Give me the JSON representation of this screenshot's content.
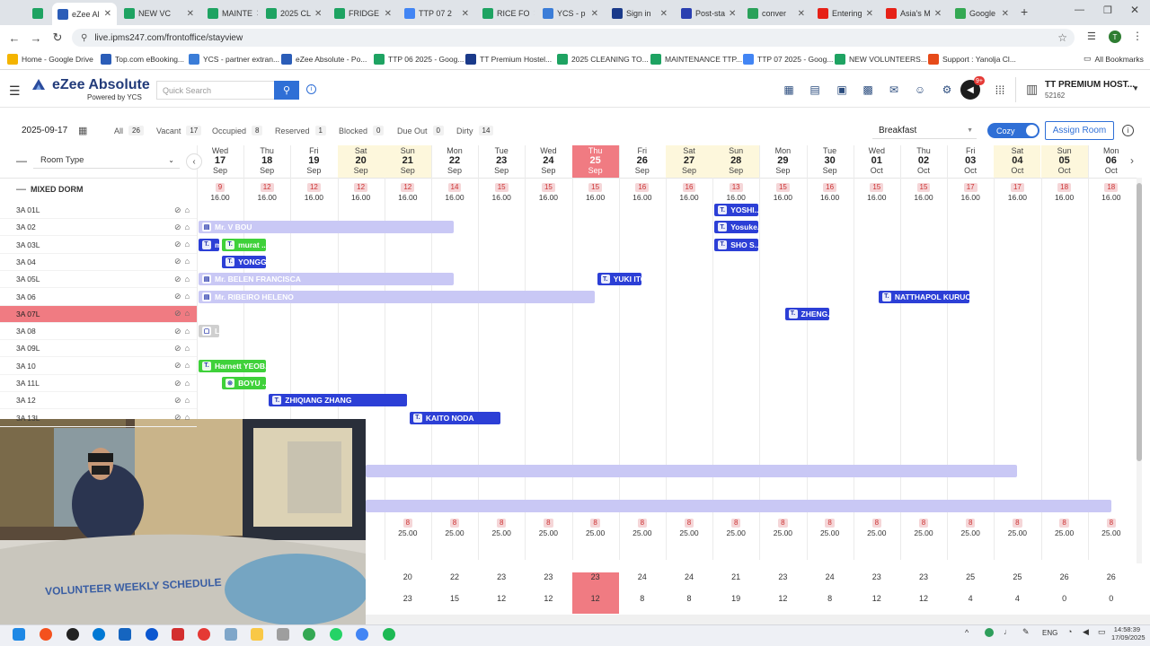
{
  "browser": {
    "tabs": [
      {
        "label": "",
        "icon": "sheets-icon",
        "color": "#1ea362"
      },
      {
        "label": "eZee Al",
        "icon": "ezee-icon",
        "color": "#2b5db8"
      },
      {
        "label": "NEW VC",
        "icon": "sheets-icon",
        "color": "#1ea362"
      },
      {
        "label": "MAINTE",
        "icon": "sheets-icon",
        "color": "#1ea362"
      },
      {
        "label": "2025 CL",
        "icon": "sheets-icon",
        "color": "#1ea362"
      },
      {
        "label": "FRIDGE",
        "icon": "fridge-icon",
        "color": "#1ea362"
      },
      {
        "label": "TTP 07 2",
        "icon": "google-icon",
        "color": "#4285f4"
      },
      {
        "label": "RICE FO",
        "icon": "sheets-icon",
        "color": "#1ea362"
      },
      {
        "label": "YCS - p",
        "icon": "ycs-icon",
        "color": "#3b7dd8"
      },
      {
        "label": "Sign in",
        "icon": "booking-icon",
        "color": "#1a3a8a"
      },
      {
        "label": "Post-sta",
        "icon": "post-icon",
        "color": "#2a3fb0"
      },
      {
        "label": "conver",
        "icon": "convert-icon",
        "color": "#2aa15a"
      },
      {
        "label": "Entering",
        "icon": "youtube-icon",
        "color": "#e62117"
      },
      {
        "label": "Asia's M",
        "icon": "youtube-icon",
        "color": "#e62117"
      },
      {
        "label": "Google",
        "icon": "google-maps-icon",
        "color": "#34a853"
      }
    ],
    "url": "live.ipms247.com/frontoffice/stayview",
    "bookmarks": [
      {
        "label": "Home - Google Drive",
        "color": "#f4b400"
      },
      {
        "label": "Top.com eBooking...",
        "color": "#2b5db8"
      },
      {
        "label": "YCS - partner extran...",
        "color": "#3b7dd8"
      },
      {
        "label": "eZee Absolute - Po...",
        "color": "#2b5db8"
      },
      {
        "label": "TTP 06 2025 - Goog...",
        "color": "#1ea362"
      },
      {
        "label": "TT Premium Hostel...",
        "color": "#1a3a8a"
      },
      {
        "label": "2025 CLEANING TO...",
        "color": "#1ea362"
      },
      {
        "label": "MAINTENANCE TTP...",
        "color": "#1ea362"
      },
      {
        "label": "TTP 07 2025 - Goog...",
        "color": "#4285f4"
      },
      {
        "label": "NEW VOLUNTEERS...",
        "color": "#1ea362"
      },
      {
        "label": "Support : Yanolja Cl...",
        "color": "#e64a19"
      }
    ],
    "all_bookmarks": "All Bookmarks"
  },
  "app": {
    "logo": "eZee Absolute",
    "logo_sub": "Powered by YCS",
    "search_placeholder": "Quick Search",
    "notif_count": "9+",
    "hotel_name": "TT PREMIUM HOST...",
    "hotel_id": "52162"
  },
  "filter": {
    "date": "2025-09-17",
    "stats": [
      {
        "label": "All",
        "count": "26"
      },
      {
        "label": "Vacant",
        "count": "17"
      },
      {
        "label": "Occupied",
        "count": "8"
      },
      {
        "label": "Reserved",
        "count": "1"
      },
      {
        "label": "Blocked",
        "count": "0"
      },
      {
        "label": "Due Out",
        "count": "0"
      },
      {
        "label": "Dirty",
        "count": "14"
      }
    ],
    "meal": "Breakfast",
    "view_toggle": "Cozy",
    "assign_room": "Assign Room",
    "room_type": "Room Type"
  },
  "calendar": {
    "days": [
      {
        "dow": "Wed",
        "d": "17",
        "m": "Sep",
        "avail": "9",
        "price": "16.00",
        "kind": ""
      },
      {
        "dow": "Thu",
        "d": "18",
        "m": "Sep",
        "avail": "12",
        "price": "16.00",
        "kind": ""
      },
      {
        "dow": "Fri",
        "d": "19",
        "m": "Sep",
        "avail": "12",
        "price": "16.00",
        "kind": ""
      },
      {
        "dow": "Sat",
        "d": "20",
        "m": "Sep",
        "avail": "12",
        "price": "16.00",
        "kind": "weekend"
      },
      {
        "dow": "Sun",
        "d": "21",
        "m": "Sep",
        "avail": "12",
        "price": "16.00",
        "kind": "weekend"
      },
      {
        "dow": "Mon",
        "d": "22",
        "m": "Sep",
        "avail": "14",
        "price": "16.00",
        "kind": ""
      },
      {
        "dow": "Tue",
        "d": "23",
        "m": "Sep",
        "avail": "15",
        "price": "16.00",
        "kind": ""
      },
      {
        "dow": "Wed",
        "d": "24",
        "m": "Sep",
        "avail": "15",
        "price": "16.00",
        "kind": ""
      },
      {
        "dow": "Thu",
        "d": "25",
        "m": "Sep",
        "avail": "15",
        "price": "16.00",
        "kind": "today"
      },
      {
        "dow": "Fri",
        "d": "26",
        "m": "Sep",
        "avail": "16",
        "price": "16.00",
        "kind": ""
      },
      {
        "dow": "Sat",
        "d": "27",
        "m": "Sep",
        "avail": "16",
        "price": "16.00",
        "kind": "weekend"
      },
      {
        "dow": "Sun",
        "d": "28",
        "m": "Sep",
        "avail": "13",
        "price": "16.00",
        "kind": "weekend"
      },
      {
        "dow": "Mon",
        "d": "29",
        "m": "Sep",
        "avail": "15",
        "price": "16.00",
        "kind": ""
      },
      {
        "dow": "Tue",
        "d": "30",
        "m": "Sep",
        "avail": "16",
        "price": "16.00",
        "kind": ""
      },
      {
        "dow": "Wed",
        "d": "01",
        "m": "Oct",
        "avail": "15",
        "price": "16.00",
        "kind": ""
      },
      {
        "dow": "Thu",
        "d": "02",
        "m": "Oct",
        "avail": "15",
        "price": "16.00",
        "kind": ""
      },
      {
        "dow": "Fri",
        "d": "03",
        "m": "Oct",
        "avail": "17",
        "price": "16.00",
        "kind": ""
      },
      {
        "dow": "Sat",
        "d": "04",
        "m": "Oct",
        "avail": "17",
        "price": "16.00",
        "kind": "weekend"
      },
      {
        "dow": "Sun",
        "d": "05",
        "m": "Oct",
        "avail": "18",
        "price": "16.00",
        "kind": "weekend"
      },
      {
        "dow": "Mon",
        "d": "06",
        "m": "Oct",
        "avail": "18",
        "price": "16.00",
        "kind": ""
      }
    ],
    "section": "MIXED DORM",
    "rooms": [
      {
        "name": "3A 01L",
        "highlight": false
      },
      {
        "name": "3A 02",
        "highlight": false
      },
      {
        "name": "3A 03L",
        "highlight": false
      },
      {
        "name": "3A 04",
        "highlight": false
      },
      {
        "name": "3A 05L",
        "highlight": false
      },
      {
        "name": "3A 06",
        "highlight": false
      },
      {
        "name": "3A 07L",
        "highlight": true
      },
      {
        "name": "3A 08",
        "highlight": false
      },
      {
        "name": "3A 09L",
        "highlight": false
      },
      {
        "name": "3A 10",
        "highlight": false
      },
      {
        "name": "3A 11L",
        "highlight": false
      },
      {
        "name": "3A 12",
        "highlight": false
      },
      {
        "name": "3A 13L",
        "highlight": false
      }
    ],
    "bookings": [
      {
        "room": 0,
        "start": 11,
        "span": 1,
        "label": "YOSHI...",
        "style": "blue",
        "src": "T."
      },
      {
        "room": 1,
        "start": 0,
        "span": 5.5,
        "label": "Mr. V BOU",
        "style": "lav",
        "src": "▤"
      },
      {
        "room": 1,
        "start": 11,
        "span": 1,
        "label": "Yosuke...",
        "style": "blue",
        "src": "T."
      },
      {
        "room": 2,
        "start": 0,
        "span": 0.5,
        "label": "m",
        "style": "blue",
        "src": "T."
      },
      {
        "room": 2,
        "start": 0.5,
        "span": 1,
        "label": "murat ...",
        "style": "green",
        "src": "T."
      },
      {
        "room": 2,
        "start": 11,
        "span": 1,
        "label": "SHO S...",
        "style": "blue",
        "src": "T."
      },
      {
        "room": 3,
        "start": 0.5,
        "span": 1,
        "label": "YONGG...",
        "style": "blue",
        "src": "T."
      },
      {
        "room": 4,
        "start": 0,
        "span": 5.5,
        "label": "Mr. BELEN FRANCISCA",
        "style": "lav",
        "src": "▤"
      },
      {
        "room": 4,
        "start": 8.5,
        "span": 1,
        "label": "YUKI ITO",
        "style": "blue",
        "src": "T."
      },
      {
        "room": 5,
        "start": 0,
        "span": 8.5,
        "label": "Mr. RIBEIRO HELENO",
        "style": "lav",
        "src": "▤"
      },
      {
        "room": 5,
        "start": 14.5,
        "span": 2,
        "label": "NATTHAPOL KURUC...",
        "style": "blue",
        "src": "T."
      },
      {
        "room": 6,
        "start": 12.5,
        "span": 1,
        "label": "ZHENG...",
        "style": "blue",
        "src": "T."
      },
      {
        "room": 7,
        "start": 0,
        "span": 0.5,
        "label": "L",
        "style": "gray",
        "src": "▢"
      },
      {
        "room": 9,
        "start": 0,
        "span": 1.5,
        "label": "Harnett YEOB...",
        "style": "green",
        "src": "T."
      },
      {
        "room": 10,
        "start": 0.5,
        "span": 1,
        "label": "BOYU ...",
        "style": "green",
        "src": "⊚"
      },
      {
        "room": 11,
        "start": 1.5,
        "span": 3,
        "label": "ZHIQIANG ZHANG",
        "style": "blue",
        "src": "T."
      },
      {
        "room": 12,
        "start": 4.5,
        "span": 2,
        "label": "KAITO NODA",
        "style": "blue",
        "src": "T."
      }
    ],
    "long_bars": [
      {
        "start": 3.6,
        "span": 13.9
      },
      {
        "start": 3.6,
        "span": 15.9
      }
    ],
    "second_type": {
      "avail": "8",
      "price": "25.00"
    },
    "totals_row1": [
      "",
      "",
      "",
      "",
      "20",
      "22",
      "23",
      "23",
      "23",
      "24",
      "24",
      "21",
      "23",
      "24",
      "23",
      "23",
      "25",
      "25",
      "26",
      "26"
    ],
    "totals_row2": [
      "",
      "",
      "",
      "",
      "23",
      "15",
      "12",
      "12",
      "12",
      "8",
      "8",
      "19",
      "12",
      "8",
      "12",
      "12",
      "4",
      "4",
      "0",
      "0"
    ]
  },
  "video": {
    "poster_title": "VOLUNTEER WEEKLY SCHEDULE"
  },
  "taskbar": {
    "lang": "ENG",
    "time": "14:58:39",
    "date": "17/09/2025"
  }
}
